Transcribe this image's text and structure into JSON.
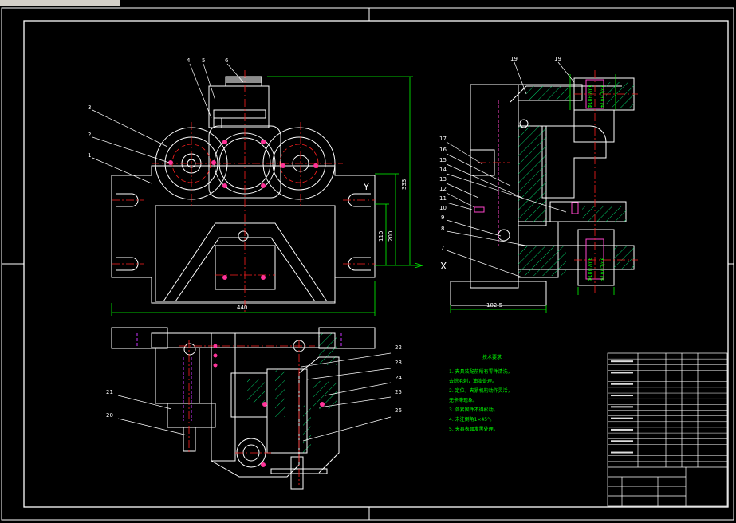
{
  "colors": {
    "background": "#000000",
    "frame": "#ffffff",
    "center": "#ff2020",
    "dim": "#00ff00",
    "hatch": "#00cc66",
    "hidden": "#cc33ff",
    "pink": "#ff55cc"
  },
  "balloons_front": [
    "4",
    "5",
    "6",
    "3",
    "2",
    "1"
  ],
  "balloons_side": [
    "19",
    "19",
    "17",
    "16",
    "15",
    "14",
    "13",
    "12",
    "11",
    "10",
    "9",
    "8",
    "7"
  ],
  "balloons_bottom": [
    "22",
    "23",
    "24",
    "25",
    "26",
    "21",
    "20"
  ],
  "dims": {
    "width": "440",
    "height_total": "333",
    "h1": "200",
    "h2": "110",
    "side_width": "182.5",
    "y_mark": "Y",
    "x_mark": "X"
  },
  "notes": {
    "title": "技术要求",
    "lines": [
      "1. 夹具装配前所有零件清洗，",
      "去除毛刺，油漆处理。",
      "2. 定位，夹紧机构动作灵活，",
      "无卡滞现象。",
      "3. 各紧固件不得松动。",
      "4. 未注倒角1×45°。",
      "5. 夹具表面发黑处理。"
    ]
  },
  "title_block": {
    "rows": 20
  }
}
